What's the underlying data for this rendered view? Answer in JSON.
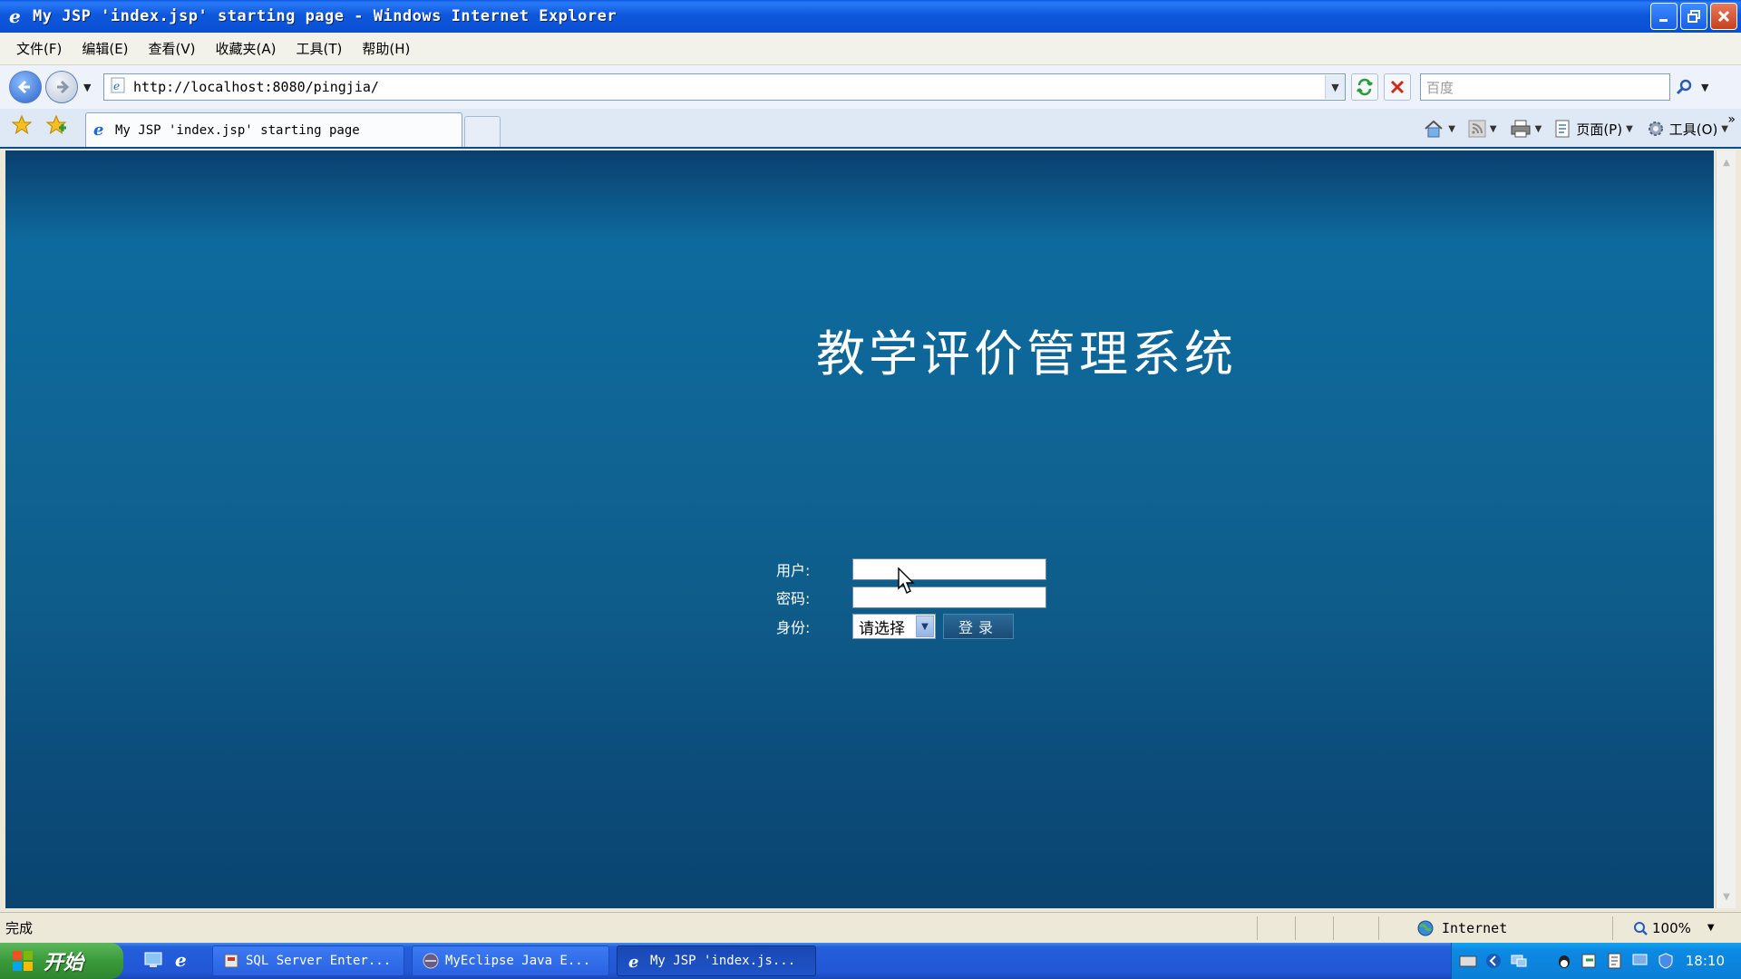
{
  "window": {
    "title": "My JSP 'index.jsp' starting page - Windows Internet Explorer"
  },
  "menu": [
    "文件(F)",
    "编辑(E)",
    "查看(V)",
    "收藏夹(A)",
    "工具(T)",
    "帮助(H)"
  ],
  "address": {
    "url": "http://localhost:8080/pingjia/",
    "search_placeholder": "百度"
  },
  "tab": {
    "title": "My JSP 'index.jsp' starting page"
  },
  "commandbar": {
    "page_label": "页面(P)",
    "tools_label": "工具(O)"
  },
  "page": {
    "title": "教学评价管理系统",
    "user_label": "用户:",
    "password_label": "密码:",
    "role_label": "身份:",
    "role_selected": "请选择",
    "login_label": "登录",
    "user_value": "",
    "password_value": ""
  },
  "status": {
    "text": "完成",
    "zone": "Internet",
    "zoom": "100%"
  },
  "taskbar": {
    "start_label": "开始",
    "tasks": [
      {
        "label": "SQL Server Enter..."
      },
      {
        "label": "MyEclipse Java E..."
      },
      {
        "label": "My JSP 'index.js..."
      }
    ],
    "clock": "18:10"
  },
  "colors": {
    "title_bar": "#0a58e0",
    "content_bg": "#0f6494",
    "taskbar": "#245edb",
    "start_button": "#3a9a3a"
  }
}
